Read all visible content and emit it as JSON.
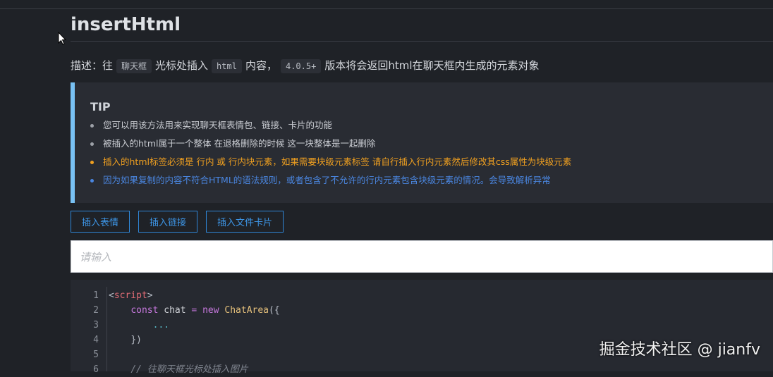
{
  "page": {
    "title": "insertHtml"
  },
  "description": {
    "prefix": "描述：往",
    "code1": "聊天框",
    "mid1": "光标处插入",
    "code2": "html",
    "mid2": "内容，",
    "code3": "4.0.5+",
    "suffix": "版本将会返回html在聊天框内生成的元素对象"
  },
  "tip": {
    "title": "TIP",
    "items": [
      {
        "text": "您可以用该方法用来实现聊天框表情包、链接、卡片的功能",
        "color": "#c9ccd2"
      },
      {
        "text": "被插入的html属于一个整体 在退格删除的时候 这一块整体是一起删除",
        "color": "#c9ccd2"
      },
      {
        "text": "插入的html标签必须是 行内 或 行内块元素，如果需要块级元素标签 请自行插入行内元素然后修改其css属性为块级元素",
        "color": "#f0a020"
      },
      {
        "text": "因为如果复制的内容不符合HTML的语法规则，或者包含了不允许的行内元素包含块级元素的情况。会导致解析异常",
        "color": "#4a86e0"
      }
    ]
  },
  "buttons": {
    "emoji": "插入表情",
    "link": "插入链接",
    "file_card": "插入文件卡片"
  },
  "input": {
    "placeholder": "请输入",
    "value": ""
  },
  "code": {
    "line_numbers": [
      "1",
      "2",
      "3",
      "4",
      "5",
      "6"
    ],
    "l1": {
      "open": "<",
      "tag": "script",
      "close": ">"
    },
    "l2": {
      "kw1": "const",
      "id": " chat ",
      "op": "= ",
      "kw2": "new ",
      "cls": "ChatArea",
      "rest": "({"
    },
    "l3": "...",
    "l4": "})",
    "l6": "// 往聊天框光标处插入图片"
  },
  "watermark": "掘金技术社区 @ jianfv"
}
